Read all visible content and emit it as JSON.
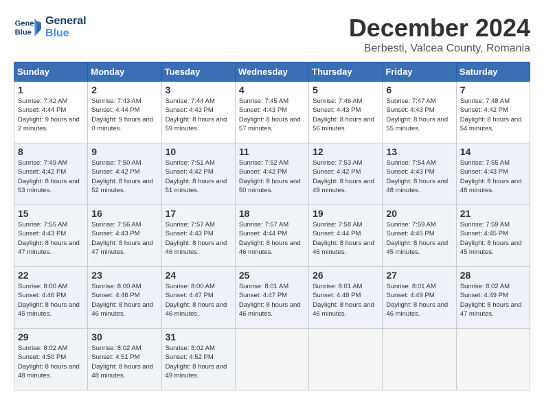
{
  "header": {
    "logo_line1": "General",
    "logo_line2": "Blue",
    "month_title": "December 2024",
    "location": "Berbesti, Valcea County, Romania"
  },
  "days_of_week": [
    "Sunday",
    "Monday",
    "Tuesday",
    "Wednesday",
    "Thursday",
    "Friday",
    "Saturday"
  ],
  "weeks": [
    [
      {
        "day": "1",
        "sunrise": "7:42 AM",
        "sunset": "4:44 PM",
        "daylight": "9 hours and 2 minutes."
      },
      {
        "day": "2",
        "sunrise": "7:43 AM",
        "sunset": "4:44 PM",
        "daylight": "9 hours and 0 minutes."
      },
      {
        "day": "3",
        "sunrise": "7:44 AM",
        "sunset": "4:43 PM",
        "daylight": "8 hours and 59 minutes."
      },
      {
        "day": "4",
        "sunrise": "7:45 AM",
        "sunset": "4:43 PM",
        "daylight": "8 hours and 57 minutes."
      },
      {
        "day": "5",
        "sunrise": "7:46 AM",
        "sunset": "4:43 PM",
        "daylight": "8 hours and 56 minutes."
      },
      {
        "day": "6",
        "sunrise": "7:47 AM",
        "sunset": "4:43 PM",
        "daylight": "8 hours and 55 minutes."
      },
      {
        "day": "7",
        "sunrise": "7:48 AM",
        "sunset": "4:42 PM",
        "daylight": "8 hours and 54 minutes."
      }
    ],
    [
      {
        "day": "8",
        "sunrise": "7:49 AM",
        "sunset": "4:42 PM",
        "daylight": "8 hours and 53 minutes."
      },
      {
        "day": "9",
        "sunrise": "7:50 AM",
        "sunset": "4:42 PM",
        "daylight": "8 hours and 52 minutes."
      },
      {
        "day": "10",
        "sunrise": "7:51 AM",
        "sunset": "4:42 PM",
        "daylight": "8 hours and 51 minutes."
      },
      {
        "day": "11",
        "sunrise": "7:52 AM",
        "sunset": "4:42 PM",
        "daylight": "8 hours and 50 minutes."
      },
      {
        "day": "12",
        "sunrise": "7:53 AM",
        "sunset": "4:42 PM",
        "daylight": "8 hours and 49 minutes."
      },
      {
        "day": "13",
        "sunrise": "7:54 AM",
        "sunset": "4:43 PM",
        "daylight": "8 hours and 48 minutes."
      },
      {
        "day": "14",
        "sunrise": "7:55 AM",
        "sunset": "4:43 PM",
        "daylight": "8 hours and 48 minutes."
      }
    ],
    [
      {
        "day": "15",
        "sunrise": "7:55 AM",
        "sunset": "4:43 PM",
        "daylight": "8 hours and 47 minutes."
      },
      {
        "day": "16",
        "sunrise": "7:56 AM",
        "sunset": "4:43 PM",
        "daylight": "8 hours and 47 minutes."
      },
      {
        "day": "17",
        "sunrise": "7:57 AM",
        "sunset": "4:43 PM",
        "daylight": "8 hours and 46 minutes."
      },
      {
        "day": "18",
        "sunrise": "7:57 AM",
        "sunset": "4:44 PM",
        "daylight": "8 hours and 46 minutes."
      },
      {
        "day": "19",
        "sunrise": "7:58 AM",
        "sunset": "4:44 PM",
        "daylight": "8 hours and 46 minutes."
      },
      {
        "day": "20",
        "sunrise": "7:59 AM",
        "sunset": "4:45 PM",
        "daylight": "8 hours and 45 minutes."
      },
      {
        "day": "21",
        "sunrise": "7:59 AM",
        "sunset": "4:45 PM",
        "daylight": "8 hours and 45 minutes."
      }
    ],
    [
      {
        "day": "22",
        "sunrise": "8:00 AM",
        "sunset": "4:46 PM",
        "daylight": "8 hours and 45 minutes."
      },
      {
        "day": "23",
        "sunrise": "8:00 AM",
        "sunset": "4:46 PM",
        "daylight": "8 hours and 46 minutes."
      },
      {
        "day": "24",
        "sunrise": "8:00 AM",
        "sunset": "4:47 PM",
        "daylight": "8 hours and 46 minutes."
      },
      {
        "day": "25",
        "sunrise": "8:01 AM",
        "sunset": "4:47 PM",
        "daylight": "8 hours and 46 minutes."
      },
      {
        "day": "26",
        "sunrise": "8:01 AM",
        "sunset": "4:48 PM",
        "daylight": "8 hours and 46 minutes."
      },
      {
        "day": "27",
        "sunrise": "8:01 AM",
        "sunset": "4:49 PM",
        "daylight": "8 hours and 46 minutes."
      },
      {
        "day": "28",
        "sunrise": "8:02 AM",
        "sunset": "4:49 PM",
        "daylight": "8 hours and 47 minutes."
      }
    ],
    [
      {
        "day": "29",
        "sunrise": "8:02 AM",
        "sunset": "4:50 PM",
        "daylight": "8 hours and 48 minutes."
      },
      {
        "day": "30",
        "sunrise": "8:02 AM",
        "sunset": "4:51 PM",
        "daylight": "8 hours and 48 minutes."
      },
      {
        "day": "31",
        "sunrise": "8:02 AM",
        "sunset": "4:52 PM",
        "daylight": "8 hours and 49 minutes."
      },
      null,
      null,
      null,
      null
    ]
  ]
}
